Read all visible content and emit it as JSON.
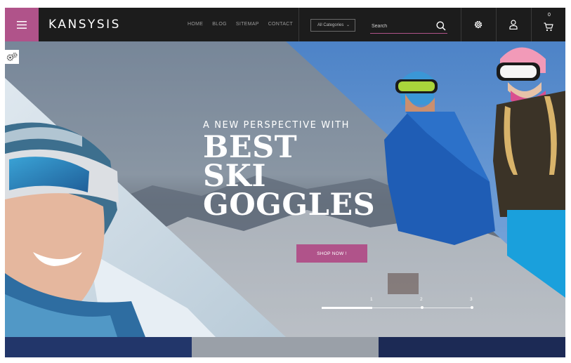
{
  "header": {
    "brand": "KANSYSIS",
    "nav": [
      "HOME",
      "BLOG",
      "SITEMAP",
      "CONTACT"
    ],
    "category_select": "All Categories",
    "search_placeholder": "Search",
    "cart_count": "0",
    "accent_color": "#b0538a"
  },
  "hero": {
    "subtitle": "A NEW PERSPECTIVE WITH",
    "title_lines": [
      "BEST",
      "SKI",
      "GOGGLES"
    ],
    "cta": "SHOP NOW !",
    "slides": [
      "1",
      "2",
      "3"
    ],
    "active_slide": 1
  },
  "icons": {
    "menu": "hamburger-icon",
    "search": "search-icon",
    "settings": "gear-icon",
    "account": "user-icon",
    "cart": "cart-icon",
    "theme_settings": "gears-icon"
  }
}
